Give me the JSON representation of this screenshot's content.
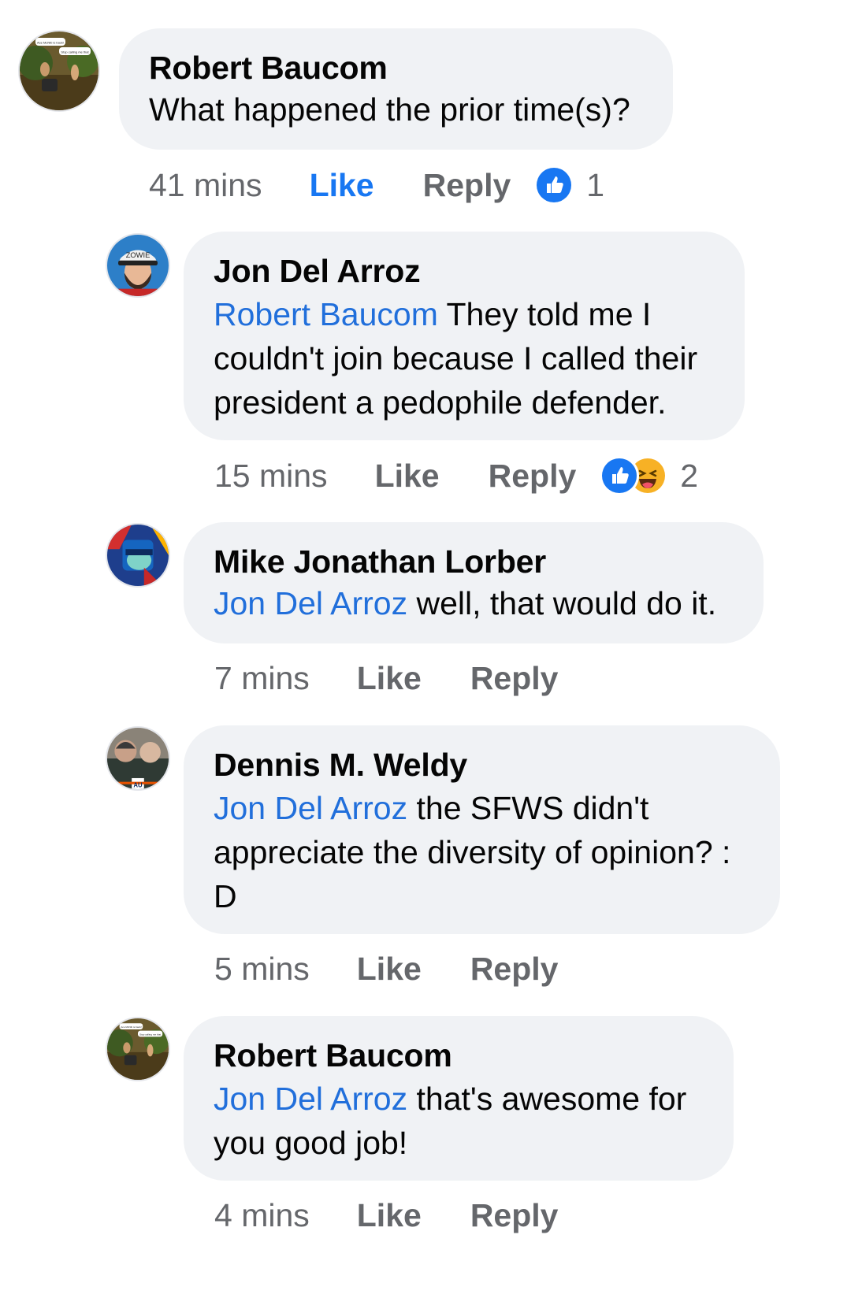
{
  "comments": [
    {
      "author": "Robert Baucom",
      "mention": "",
      "text": "What happened the prior time(s)?",
      "time": "41 mins",
      "like_label": "Like",
      "reply_label": "Reply",
      "reactions": [
        "like"
      ],
      "reaction_count": "1",
      "avatar_caption_1": "Ace McNib is back!",
      "avatar_caption_2": "Stop calling me that"
    },
    {
      "author": "Jon Del Arroz",
      "mention": "Robert Baucom",
      "text": " They told me I couldn't join because I called their president a pedophile defender.",
      "time": "15 mins",
      "like_label": "Like",
      "reply_label": "Reply",
      "reactions": [
        "like",
        "haha"
      ],
      "reaction_count": "2",
      "avatar_caption_1": "ZOWIE"
    },
    {
      "author": "Mike Jonathan Lorber",
      "mention": "Jon Del Arroz",
      "text": " well, that would do it.",
      "time": "7 mins",
      "like_label": "Like",
      "reply_label": "Reply"
    },
    {
      "author": "Dennis M. Weldy",
      "mention": "Jon Del Arroz",
      "text": " the SFWS didn't appreciate the diversity of opinion? : D",
      "time": "5 mins",
      "like_label": "Like",
      "reply_label": "Reply"
    },
    {
      "author": "Robert Baucom",
      "mention": "Jon Del Arroz",
      "text": " that's awesome for you good job!",
      "time": "4 mins",
      "like_label": "Like",
      "reply_label": "Reply",
      "avatar_caption_1": "Ace McNib is back!",
      "avatar_caption_2": "Stop calling me that"
    }
  ],
  "colors": {
    "bubble": "#f0f2f5",
    "mention": "#216fdb",
    "like_active": "#1877f2",
    "meta": "#65676b"
  }
}
